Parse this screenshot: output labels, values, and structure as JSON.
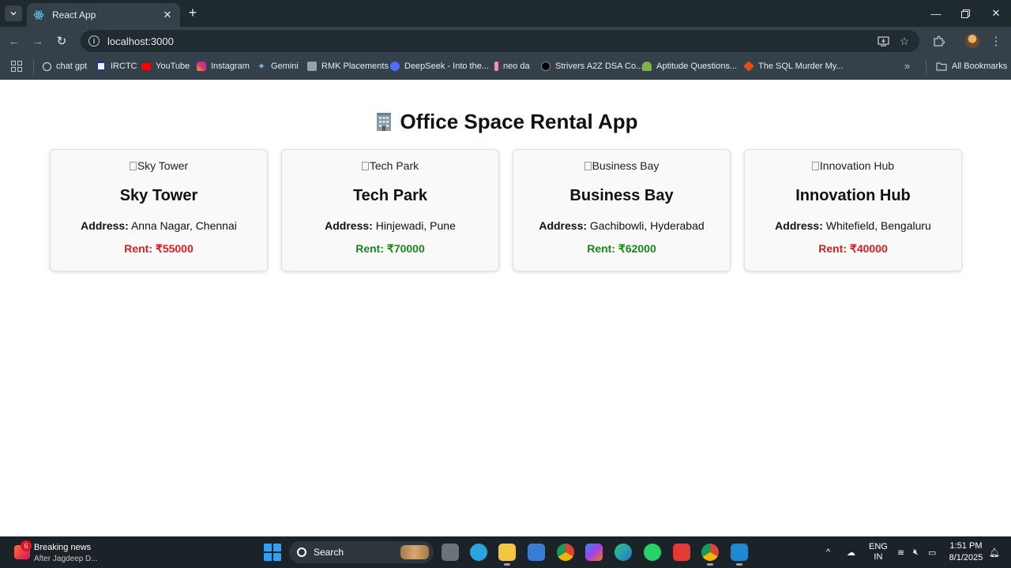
{
  "browser": {
    "tab": {
      "title": "React App"
    },
    "address": {
      "url": "localhost:3000"
    },
    "bookmarks": [
      {
        "label": "chat gpt",
        "icon": "chatgpt-icon"
      },
      {
        "label": "IRCTC",
        "icon": "irctc-icon"
      },
      {
        "label": "YouTube",
        "icon": "youtube-icon"
      },
      {
        "label": "Instagram",
        "icon": "instagram-icon"
      },
      {
        "label": "Gemini",
        "icon": "gemini-icon"
      },
      {
        "label": "RMK Placements",
        "icon": "rmk-icon"
      },
      {
        "label": "DeepSeek - Into the...",
        "icon": "deepseek-icon"
      },
      {
        "label": "neo da",
        "icon": "neo-icon"
      },
      {
        "label": "Strivers A2Z DSA Co...",
        "icon": "tuf-icon"
      },
      {
        "label": "Aptitude Questions...",
        "icon": "aptitude-icon"
      },
      {
        "label": "The SQL Murder My...",
        "icon": "sql-icon"
      }
    ],
    "all_bookmarks_label": "All Bookmarks"
  },
  "app": {
    "title": "Office Space Rental App",
    "title_icon": "office-building-icon",
    "address_label": "Address:",
    "rent_label": "Rent: ₹",
    "offices": [
      {
        "name": "Sky Tower",
        "address": "Anna Nagar, Chennai",
        "rent": "55000",
        "rent_color": "#e01b1b"
      },
      {
        "name": "Tech Park",
        "address": "Hinjewadi, Pune",
        "rent": "70000",
        "rent_color": "#168a16"
      },
      {
        "name": "Business Bay",
        "address": "Gachibowli, Hyderabad",
        "rent": "62000",
        "rent_color": "#168a16"
      },
      {
        "name": "Innovation Hub",
        "address": "Whitefield, Bengaluru",
        "rent": "40000",
        "rent_color": "#e01b1b"
      }
    ]
  },
  "taskbar": {
    "news": {
      "badge": "6",
      "title": "Breaking news",
      "subtitle": "After Jagdeep D..."
    },
    "search_placeholder": "Search",
    "lang": {
      "line1": "ENG",
      "line2": "IN"
    },
    "clock": {
      "time": "1:51 PM",
      "date": "8/1/2025"
    }
  }
}
